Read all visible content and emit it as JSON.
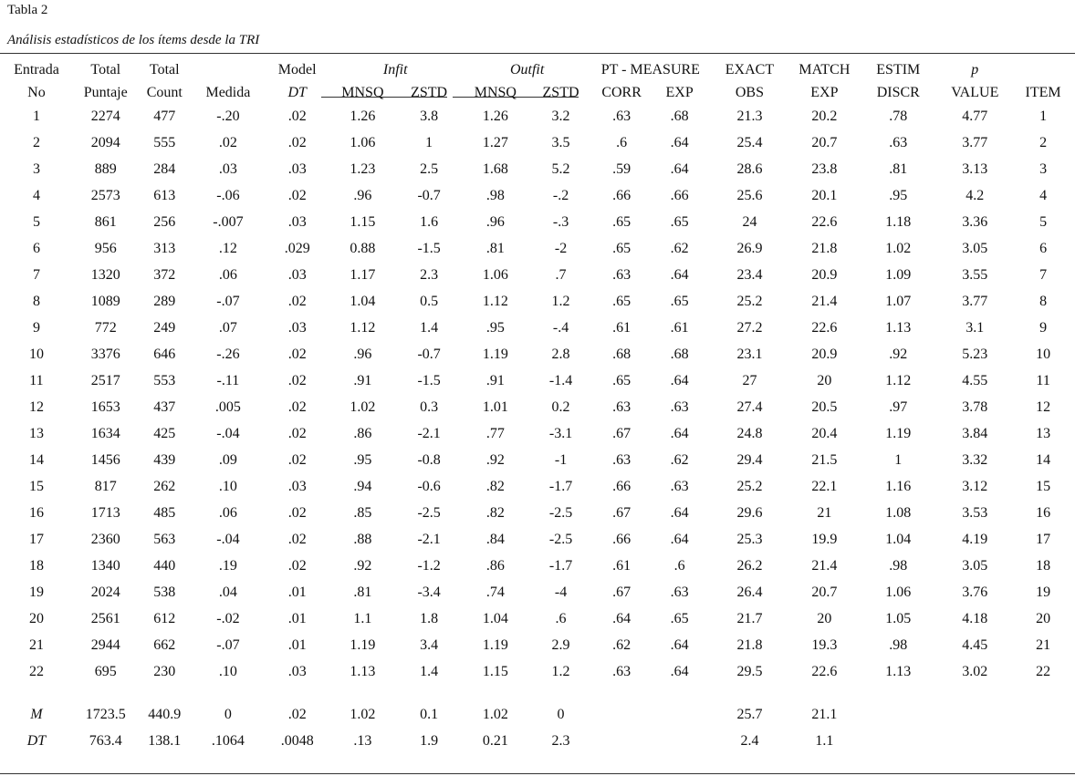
{
  "caption": {
    "label": "Tabla 2",
    "title": "Análisis estadísticos de los ítems desde la TRI"
  },
  "header": {
    "row1": [
      "Entrada",
      "Total",
      "Total",
      "",
      "Model",
      "Infit",
      "Outfit",
      "PT - MEASURE",
      "EXACT",
      "MATCH",
      "ESTIM",
      "p",
      ""
    ],
    "row2": [
      "No",
      "Puntaje",
      "Count",
      "Medida",
      "DT",
      "MNSQ",
      "ZSTD",
      "MNSQ",
      "ZSTD",
      "CORR",
      "EXP",
      "OBS",
      "EXP",
      "DISCR",
      "VALUE",
      "ITEM"
    ]
  },
  "rows": [
    [
      "1",
      "2274",
      "477",
      "-.20",
      ".02",
      "1.26",
      "3.8",
      "1.26",
      "3.2",
      ".63",
      ".68",
      "21.3",
      "20.2",
      ".78",
      "4.77",
      "1"
    ],
    [
      "2",
      "2094",
      "555",
      ".02",
      ".02",
      "1.06",
      "1",
      "1.27",
      "3.5",
      ".6",
      ".64",
      "25.4",
      "20.7",
      ".63",
      "3.77",
      "2"
    ],
    [
      "3",
      "889",
      "284",
      ".03",
      ".03",
      "1.23",
      "2.5",
      "1.68",
      "5.2",
      ".59",
      ".64",
      "28.6",
      "23.8",
      ".81",
      "3.13",
      "3"
    ],
    [
      "4",
      "2573",
      "613",
      "-.06",
      ".02",
      ".96",
      "-0.7",
      ".98",
      "-.2",
      ".66",
      ".66",
      "25.6",
      "20.1",
      ".95",
      "4.2",
      "4"
    ],
    [
      "5",
      "861",
      "256",
      "-.007",
      ".03",
      "1.15",
      "1.6",
      ".96",
      "-.3",
      ".65",
      ".65",
      "24",
      "22.6",
      "1.18",
      "3.36",
      "5"
    ],
    [
      "6",
      "956",
      "313",
      ".12",
      ".029",
      "0.88",
      "-1.5",
      ".81",
      "-2",
      ".65",
      ".62",
      "26.9",
      "21.8",
      "1.02",
      "3.05",
      "6"
    ],
    [
      "7",
      "1320",
      "372",
      ".06",
      ".03",
      "1.17",
      "2.3",
      "1.06",
      ".7",
      ".63",
      ".64",
      "23.4",
      "20.9",
      "1.09",
      "3.55",
      "7"
    ],
    [
      "8",
      "1089",
      "289",
      "-.07",
      ".02",
      "1.04",
      "0.5",
      "1.12",
      "1.2",
      ".65",
      ".65",
      "25.2",
      "21.4",
      "1.07",
      "3.77",
      "8"
    ],
    [
      "9",
      "772",
      "249",
      ".07",
      ".03",
      "1.12",
      "1.4",
      ".95",
      "-.4",
      ".61",
      ".61",
      "27.2",
      "22.6",
      "1.13",
      "3.1",
      "9"
    ],
    [
      "10",
      "3376",
      "646",
      "-.26",
      ".02",
      ".96",
      "-0.7",
      "1.19",
      "2.8",
      ".68",
      ".68",
      "23.1",
      "20.9",
      ".92",
      "5.23",
      "10"
    ],
    [
      "11",
      "2517",
      "553",
      "-.11",
      ".02",
      ".91",
      "-1.5",
      ".91",
      "-1.4",
      ".65",
      ".64",
      "27",
      "20",
      "1.12",
      "4.55",
      "11"
    ],
    [
      "12",
      "1653",
      "437",
      ".005",
      ".02",
      "1.02",
      "0.3",
      "1.01",
      "0.2",
      ".63",
      ".63",
      "27.4",
      "20.5",
      ".97",
      "3.78",
      "12"
    ],
    [
      "13",
      "1634",
      "425",
      "-.04",
      ".02",
      ".86",
      "-2.1",
      ".77",
      "-3.1",
      ".67",
      ".64",
      "24.8",
      "20.4",
      "1.19",
      "3.84",
      "13"
    ],
    [
      "14",
      "1456",
      "439",
      ".09",
      ".02",
      ".95",
      "-0.8",
      ".92",
      "-1",
      ".63",
      ".62",
      "29.4",
      "21.5",
      "1",
      "3.32",
      "14"
    ],
    [
      "15",
      "817",
      "262",
      ".10",
      ".03",
      ".94",
      "-0.6",
      ".82",
      "-1.7",
      ".66",
      ".63",
      "25.2",
      "22.1",
      "1.16",
      "3.12",
      "15"
    ],
    [
      "16",
      "1713",
      "485",
      ".06",
      ".02",
      ".85",
      "-2.5",
      ".82",
      "-2.5",
      ".67",
      ".64",
      "29.6",
      "21",
      "1.08",
      "3.53",
      "16"
    ],
    [
      "17",
      "2360",
      "563",
      "-.04",
      ".02",
      ".88",
      "-2.1",
      ".84",
      "-2.5",
      ".66",
      ".64",
      "25.3",
      "19.9",
      "1.04",
      "4.19",
      "17"
    ],
    [
      "18",
      "1340",
      "440",
      ".19",
      ".02",
      ".92",
      "-1.2",
      ".86",
      "-1.7",
      ".61",
      ".6",
      "26.2",
      "21.4",
      ".98",
      "3.05",
      "18"
    ],
    [
      "19",
      "2024",
      "538",
      ".04",
      ".01",
      ".81",
      "-3.4",
      ".74",
      "-4",
      ".67",
      ".63",
      "26.4",
      "20.7",
      "1.06",
      "3.76",
      "19"
    ],
    [
      "20",
      "2561",
      "612",
      "-.02",
      ".01",
      "1.1",
      "1.8",
      "1.04",
      ".6",
      ".64",
      ".65",
      "21.7",
      "20",
      "1.05",
      "4.18",
      "20"
    ],
    [
      "21",
      "2944",
      "662",
      "-.07",
      ".01",
      "1.19",
      "3.4",
      "1.19",
      "2.9",
      ".62",
      ".64",
      "21.8",
      "19.3",
      ".98",
      "4.45",
      "21"
    ],
    [
      "22",
      "695",
      "230",
      ".10",
      ".03",
      "1.13",
      "1.4",
      "1.15",
      "1.2",
      ".63",
      ".64",
      "29.5",
      "22.6",
      "1.13",
      "3.02",
      "22"
    ]
  ],
  "summary": [
    [
      "M",
      "1723.5",
      "440.9",
      "0",
      ".02",
      "1.02",
      "0.1",
      "1.02",
      "0",
      "",
      "",
      "25.7",
      "21.1",
      "",
      "",
      ""
    ],
    [
      "DT",
      "763.4",
      "138.1",
      ".1064",
      ".0048",
      ".13",
      "1.9",
      "0.21",
      "2.3",
      "",
      "",
      "2.4",
      "1.1",
      "",
      "",
      ""
    ]
  ]
}
